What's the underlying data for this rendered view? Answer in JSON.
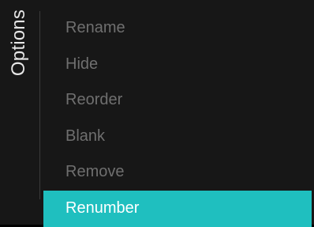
{
  "panel": {
    "title": "Options"
  },
  "menu": {
    "items": [
      {
        "label": "Rename",
        "selected": false
      },
      {
        "label": "Hide",
        "selected": false
      },
      {
        "label": "Reorder",
        "selected": false
      },
      {
        "label": "Blank",
        "selected": false
      },
      {
        "label": "Remove",
        "selected": false
      },
      {
        "label": "Renumber",
        "selected": true
      }
    ]
  },
  "colors": {
    "background": "#171717",
    "selected_background": "#1fbfbf",
    "item_text": "#6f6f6f",
    "selected_text": "#ffffff",
    "title_text": "#e6e6e6"
  }
}
